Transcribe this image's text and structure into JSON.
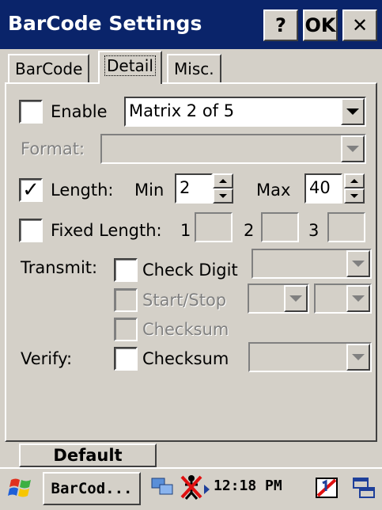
{
  "window": {
    "title": "BarCode Settings",
    "help_label": "?",
    "ok_label": "OK",
    "close_label": "✕"
  },
  "tabs": [
    {
      "label": "BarCode"
    },
    {
      "label": "Detail"
    },
    {
      "label": "Misc."
    }
  ],
  "enable": {
    "label": "Enable",
    "checked": false,
    "symbology": "Matrix 2 of 5"
  },
  "format": {
    "label": "Format:",
    "value": ""
  },
  "length": {
    "label": "Length:",
    "checked": true,
    "min_label": "Min",
    "min_value": "2",
    "max_label": "Max",
    "max_value": "40"
  },
  "fixed_length": {
    "label": "Fixed Length:",
    "checked": false,
    "n1": "1",
    "n2": "2",
    "n3": "3"
  },
  "transmit": {
    "label": "Transmit:",
    "check_digit": "Check Digit",
    "start_stop": "Start/Stop",
    "checksum": "Checksum"
  },
  "verify": {
    "label": "Verify:",
    "checksum": "Checksum"
  },
  "default_button": "Default",
  "taskbar": {
    "app_button": "BarCod...",
    "time": "12:18 PM"
  },
  "colors": {
    "titlebar": "#0a246a",
    "face": "#d4d0c8"
  }
}
